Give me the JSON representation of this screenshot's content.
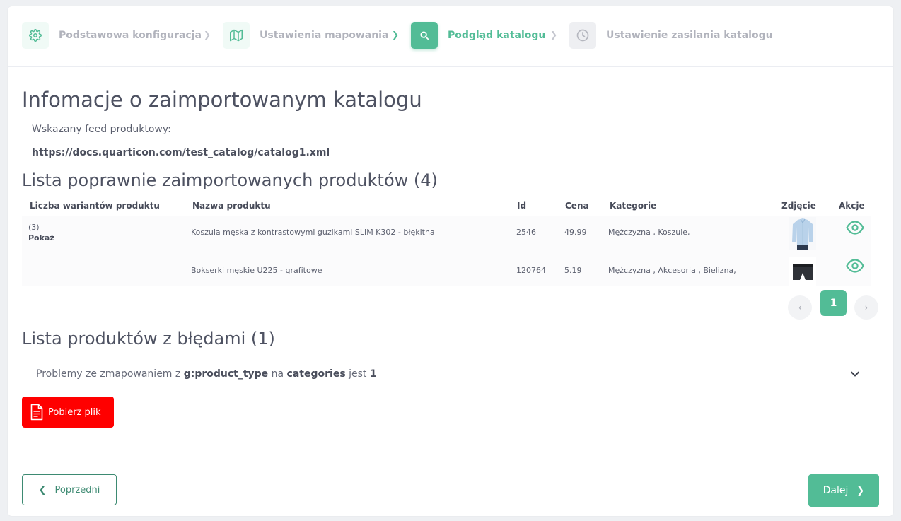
{
  "stepper": {
    "steps": [
      {
        "label": "Podstawowa konfiguracja",
        "icon": "gear-icon"
      },
      {
        "label": "Ustawienia mapowania",
        "icon": "map-icon"
      },
      {
        "label": "Podgląd katalogu",
        "icon": "search-icon"
      },
      {
        "label": "Ustawienie zasilania katalogu",
        "icon": "clock-icon"
      }
    ]
  },
  "info": {
    "title": "Infomacje o zaimportowanym katalogu",
    "feed_label": "Wskazany feed produktowy:",
    "feed_url": "https://docs.quarticon.com/test_catalog/catalog1.xml"
  },
  "products": {
    "title": "Lista poprawnie zaimportowanych produktów (4)",
    "columns": [
      "Liczba wariantów produktu",
      "Nazwa produktu",
      "Id",
      "Cena",
      "Kategorie",
      "Zdjęcie",
      "Akcje"
    ],
    "variants_count": "(3)",
    "variants_show": "Pokaż",
    "rows": [
      {
        "name": "Koszula męska z kontrastowymi guzikami SLIM K302 - błękitna",
        "id": "2546",
        "price": "49.99",
        "categories": "Mężczyzna , Koszule,"
      },
      {
        "name": "Bokserki męskie U225 - grafitowe",
        "id": "120764",
        "price": "5.19",
        "categories": "Mężczyzna , Akcesoria , Bielizna,"
      }
    ],
    "pagination": {
      "current": "1",
      "prev": "‹",
      "next": "›"
    }
  },
  "errors": {
    "title": "Lista produktów z błędami (1)",
    "row": {
      "prefix": "Problemy ze zmapowaniem z",
      "field": "g:product_type",
      "mid": "na",
      "target": "categories",
      "suffix": "jest",
      "count": "1"
    },
    "download_label": "Pobierz plik"
  },
  "nav": {
    "prev_label": "Poprzedni",
    "next_label": "Dalej"
  },
  "colors": {
    "accent": "#52bc96",
    "danger": "#ff0000",
    "outline": "#3d8a72"
  }
}
